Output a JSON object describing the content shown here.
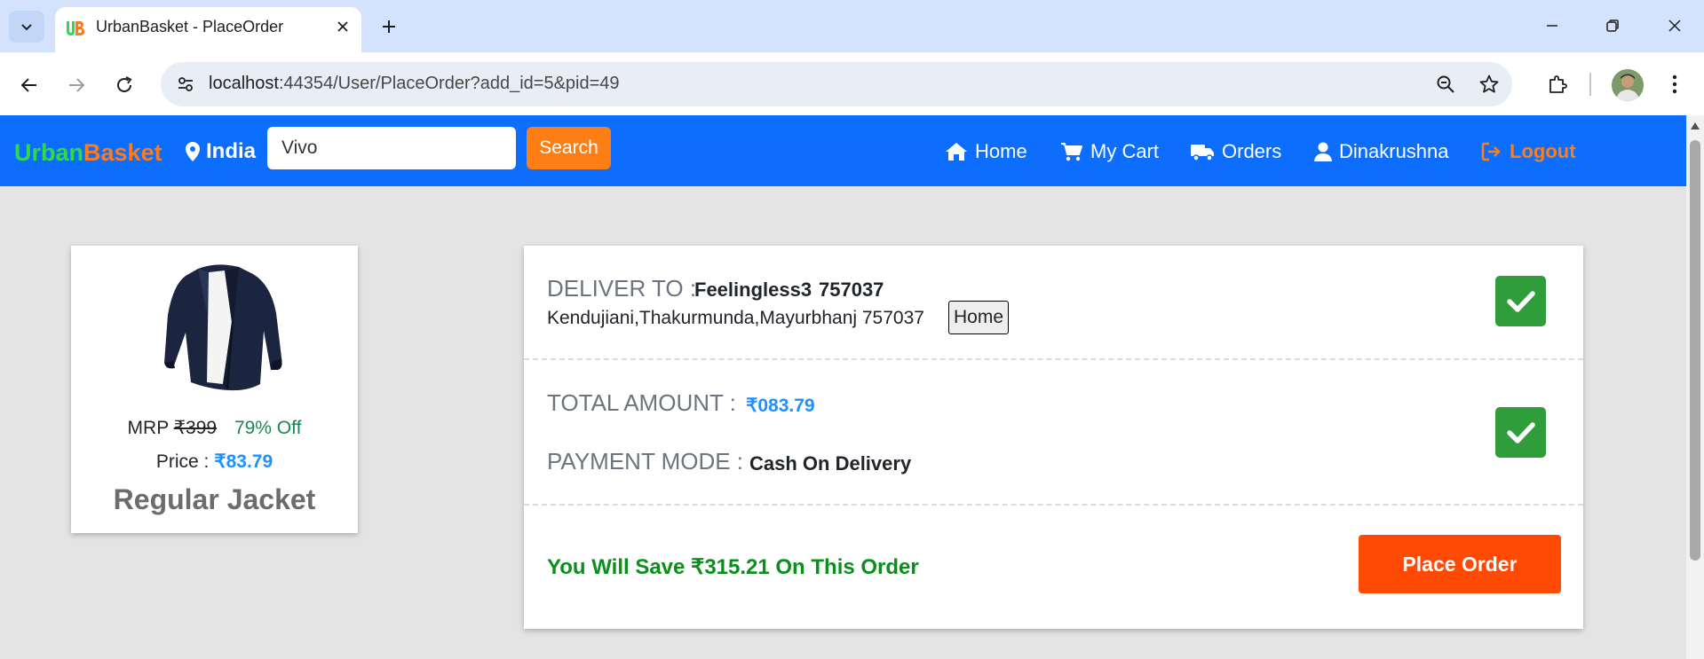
{
  "browser": {
    "tab_title": "UrbanBasket - PlaceOrder",
    "url_host": "localhost",
    "url_path": ":44354/User/PlaceOrder?add_id=5&pid=49"
  },
  "site": {
    "logo_part1": "Urban",
    "logo_part2": "Basket",
    "location": "India",
    "search_value": "Vivo",
    "search_button": "Search",
    "nav": {
      "home": "Home",
      "cart": "My Cart",
      "orders": "Orders",
      "user": "Dinakrushna",
      "logout": "Logout"
    }
  },
  "product": {
    "mrp_label": "MRP",
    "mrp_value": "₹399",
    "discount": "79% Off",
    "price_label": "Price :",
    "price_value": "₹83.79",
    "name": "Regular Jacket"
  },
  "order": {
    "deliver_label": "DELIVER TO :",
    "deliver_name": "Feelingless3",
    "deliver_pin": "757037",
    "address": "Kendujiani,Thakurmunda,Mayurbhanj 757037",
    "address_type": "Home",
    "total_label": "TOTAL AMOUNT :",
    "total_value": "₹083.79",
    "payment_label": "PAYMENT MODE :",
    "payment_value": "Cash On Delivery",
    "savings": "You Will Save ₹315.21 On This Order",
    "place_order": "Place Order"
  },
  "colors": {
    "nav_bg": "#0d6efd",
    "accent_orange": "#fd7e14",
    "place_order_bg": "#ff4a05",
    "check_green": "#2f9e3a",
    "savings_green": "#0a8f1c",
    "price_blue": "#1e90ff"
  },
  "icons": [
    "tab-list-icon",
    "favicon-icon",
    "close-icon",
    "plus-icon",
    "minimize-icon",
    "restore-icon",
    "window-close-icon",
    "back-icon",
    "forward-icon",
    "reload-icon",
    "site-info-icon",
    "zoom-icon",
    "star-icon",
    "extensions-icon",
    "avatar",
    "menu-icon",
    "location-pin-icon",
    "home-icon",
    "cart-icon",
    "truck-icon",
    "user-icon",
    "logout-icon",
    "check-icon"
  ]
}
